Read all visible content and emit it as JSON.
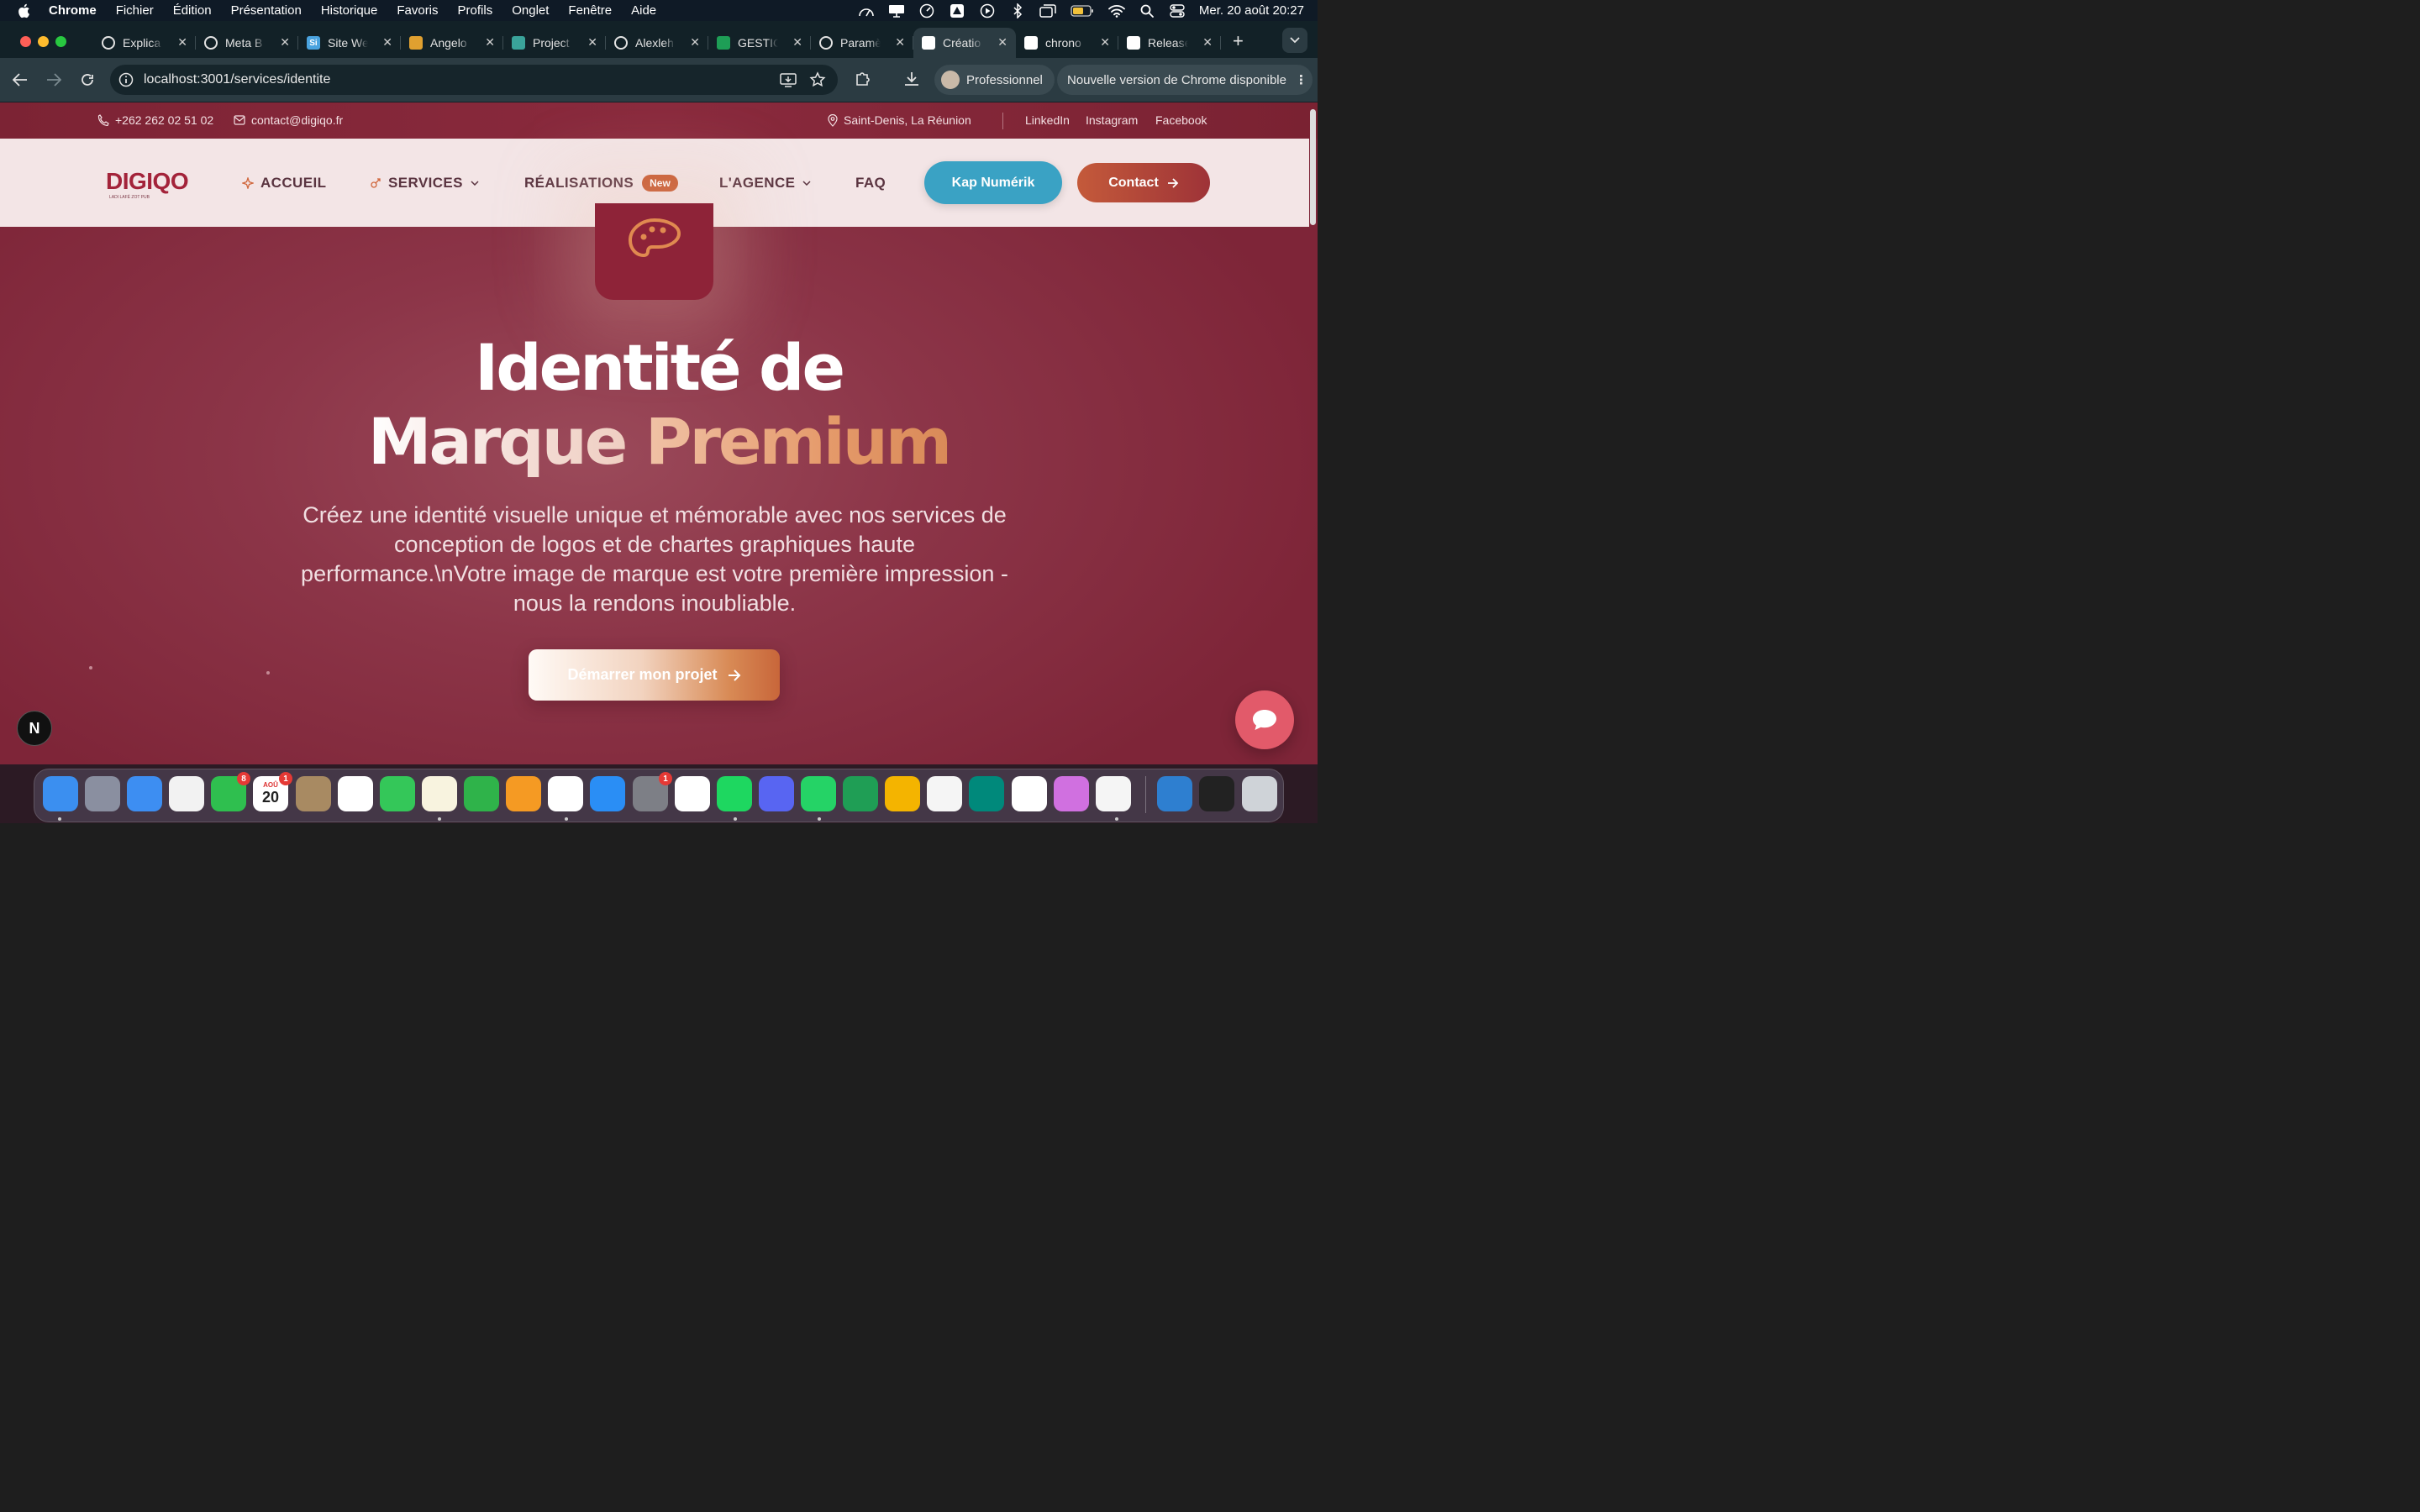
{
  "menubar": {
    "app": "Chrome",
    "items": [
      "Fichier",
      "Édition",
      "Présentation",
      "Historique",
      "Favoris",
      "Profils",
      "Onglet",
      "Fenêtre",
      "Aide"
    ],
    "clock": "Mer. 20 août  20:27"
  },
  "tabs": [
    {
      "label": "Explica",
      "icon": "openai-icon",
      "color": "#122127"
    },
    {
      "label": "Meta B",
      "icon": "meta-icon",
      "color": "#122127"
    },
    {
      "label": "Site We",
      "icon": "si-icon",
      "color": "#4aa3df"
    },
    {
      "label": "Angelo",
      "icon": "app-icon",
      "color": "#e0a030"
    },
    {
      "label": "Project",
      "icon": "diamond-icon",
      "color": "#3aa39a"
    },
    {
      "label": "Alexleh",
      "icon": "github-icon",
      "color": "#122127"
    },
    {
      "label": "GESTIC",
      "icon": "sheets-icon",
      "color": "#1e9e56"
    },
    {
      "label": "Paramè",
      "icon": "gear-icon",
      "color": "#122127"
    },
    {
      "label": "Créatio",
      "icon": "digiqo-icon",
      "color": "#ffffff",
      "active": true
    },
    {
      "label": "chrono",
      "icon": "google-icon",
      "color": "#ffffff"
    },
    {
      "label": "Release",
      "icon": "release-icon",
      "color": "#ffffff"
    }
  ],
  "toolbar": {
    "url": "localhost:3001/services/identite",
    "profile": "Professionnel",
    "update": "Nouvelle version de Chrome disponible"
  },
  "topbar": {
    "phone": "+262 262 02 51 02",
    "email": "contact@digiqo.fr",
    "location": "Saint-Denis, La Réunion",
    "socials": [
      "LinkedIn",
      "Instagram",
      "Facebook"
    ]
  },
  "nav": {
    "logo": "DIGIQO",
    "logo_tagline": "LADI LAFÉ ZOT PUB",
    "accueil": "ACCUEIL",
    "services": "SERVICES",
    "realisations": "RÉALISATIONS",
    "new_badge": "New",
    "agence": "L'AGENCE",
    "faq": "FAQ",
    "kap": "Kap Numérik",
    "contact": "Contact"
  },
  "hero": {
    "title_line1": "Identité de",
    "title_word1": "Marque",
    "title_word2": "Premium",
    "subtitle": "Créez une identité visuelle unique et mémorable avec nos services de conception de logos et de chartes graphiques haute performance.\\nVotre image de marque est votre première impression - nous la rendons inoubliable.",
    "cta": "Démarrer mon projet"
  },
  "next_badge": "N",
  "dock": [
    {
      "name": "Finder",
      "icon": "finder-icon",
      "color": "#3b8ff0"
    },
    {
      "name": "Launchpad",
      "icon": "launchpad-icon",
      "color": "#8a8fa0"
    },
    {
      "name": "Mail",
      "icon": "mail-icon",
      "color": "#3d8ef2"
    },
    {
      "name": "Photos",
      "icon": "photos-icon",
      "color": "#f2f2f2"
    },
    {
      "name": "FaceTime",
      "icon": "facetime-icon",
      "color": "#2fbf4f",
      "badge": "8"
    },
    {
      "name": "Calendar",
      "icon": "calendar-icon",
      "color": "#ffffff",
      "badge": "1",
      "text": "20",
      "month": "AOÛ"
    },
    {
      "name": "Contacts",
      "icon": "contacts-icon",
      "color": "#a88a62"
    },
    {
      "name": "Reminders",
      "icon": "reminders-icon",
      "color": "#ffffff"
    },
    {
      "name": "Messages",
      "icon": "messages-icon",
      "color": "#34c759"
    },
    {
      "name": "Notes",
      "icon": "notes-icon",
      "color": "#f8f3df"
    },
    {
      "name": "Numbers",
      "icon": "numbers-icon",
      "color": "#2fb34a"
    },
    {
      "name": "Pages",
      "icon": "pages-icon",
      "color": "#f59a23"
    },
    {
      "name": "Chrome",
      "icon": "chrome-icon",
      "color": "#ffffff"
    },
    {
      "name": "App Store",
      "icon": "appstore-icon",
      "color": "#2a8ef5"
    },
    {
      "name": "System Settings",
      "icon": "settings-icon",
      "color": "#7d7f86",
      "badge": "1"
    },
    {
      "name": "CapCut",
      "icon": "capcut-icon",
      "color": "#ffffff"
    },
    {
      "name": "Spotify",
      "icon": "spotify-icon",
      "color": "#1ed760"
    },
    {
      "name": "Discord",
      "icon": "discord-icon",
      "color": "#5865f2"
    },
    {
      "name": "WhatsApp",
      "icon": "whatsapp-icon",
      "color": "#25d366"
    },
    {
      "name": "Google Chat",
      "icon": "gchat-icon",
      "color": "#1f9e55"
    },
    {
      "name": "Pinwheel",
      "icon": "pinwheel-icon",
      "color": "#f4b400"
    },
    {
      "name": "Google Drive",
      "icon": "drive-icon",
      "color": "#f5f5f5"
    },
    {
      "name": "Google Meet",
      "icon": "meet-icon",
      "color": "#00897b"
    },
    {
      "name": "Slack",
      "icon": "slack-icon",
      "color": "#ffffff"
    },
    {
      "name": "Screen",
      "icon": "screen-icon",
      "color": "#d070e0"
    },
    {
      "name": "VS Code",
      "icon": "vscode-icon",
      "color": "#f5f5f5"
    },
    {
      "name": "Globe",
      "icon": "globe-icon",
      "color": "#2e7fd0"
    },
    {
      "name": "Window",
      "icon": "window-icon",
      "color": "#222222"
    },
    {
      "name": "Trash",
      "icon": "trash-icon",
      "color": "#cfd3d8"
    }
  ]
}
